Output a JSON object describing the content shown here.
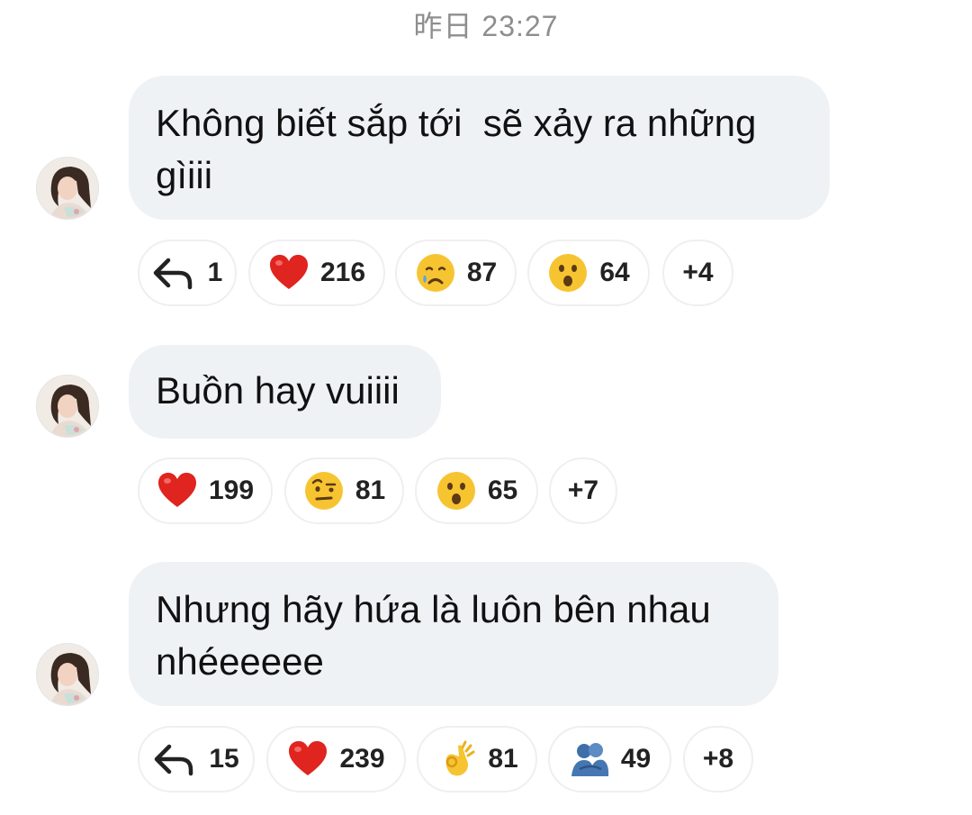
{
  "timestamp": "昨日 23:27",
  "messages": [
    {
      "text": "Không biết sắp tới  sẽ xảy ra những\ngìiii",
      "reactions": [
        {
          "icon": "reply-arrow-icon",
          "count": "1"
        },
        {
          "icon": "red-heart-emoji",
          "count": "216"
        },
        {
          "icon": "crying-face-emoji",
          "count": "87"
        },
        {
          "icon": "surprised-face-emoji",
          "count": "64"
        },
        {
          "icon": "more",
          "count": "+4"
        }
      ]
    },
    {
      "text": "Buồn hay vuiiii",
      "reactions": [
        {
          "icon": "red-heart-emoji",
          "count": "199"
        },
        {
          "icon": "raised-eyebrow-emoji",
          "count": "81"
        },
        {
          "icon": "surprised-face-emoji",
          "count": "65"
        },
        {
          "icon": "more",
          "count": "+7"
        }
      ]
    },
    {
      "text": "Nhưng hãy hứa là luôn bên nhau\nnhéeeeee",
      "reactions": [
        {
          "icon": "reply-arrow-icon",
          "count": "15"
        },
        {
          "icon": "red-heart-emoji",
          "count": "239"
        },
        {
          "icon": "ok-hand-emoji",
          "count": "81"
        },
        {
          "icon": "people-hugging-emoji",
          "count": "49"
        },
        {
          "icon": "more",
          "count": "+8"
        }
      ]
    }
  ],
  "colors": {
    "bubble": "#eff2f5",
    "timestamp": "#8e8e8e",
    "pill_border": "#efefef",
    "heart": "#e0241f"
  }
}
